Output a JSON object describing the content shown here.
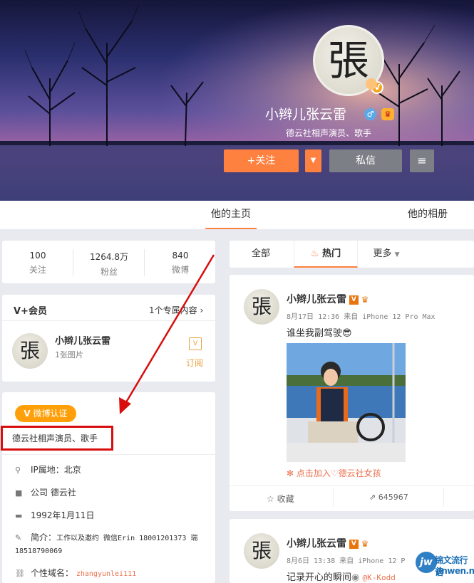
{
  "profile": {
    "avatar_glyph": "張",
    "name": "小辫儿张云雷",
    "description": "德云社相声演员、歌手",
    "follow_label": "+关注",
    "message_label": "私信"
  },
  "tabs": {
    "home": "他的主页",
    "album": "他的相册"
  },
  "stats": [
    {
      "value": "100",
      "label": "关注"
    },
    {
      "value": "1264.8万",
      "label": "粉丝"
    },
    {
      "value": "840",
      "label": "微博"
    }
  ],
  "member": {
    "title": "V+会员",
    "exclusive_link": "1个专属内容",
    "name": "小辫儿张云雷",
    "images": "1张图片",
    "subscribe": "订阅"
  },
  "verify": {
    "badge": "微博认证",
    "text": "德云社相声演员、歌手",
    "ip": "IP属地：北京",
    "company_label": "公司",
    "company": "德云社",
    "birthday": "1992年1月11日",
    "intro_label": "简介：",
    "intro": "工作以及邀约 微信Erin 18001201373 瑞18518790069",
    "domain_label": "个性域名：",
    "domain": "zhangyunlei111"
  },
  "feed": {
    "tab_all": "全部",
    "tab_hot": "热门",
    "tab_more": "更多",
    "post1": {
      "name": "小辫儿张云雷",
      "meta": "8月17日 12:36 来自 iPhone 12 Pro Max",
      "text": "谁坐我副驾驶😎",
      "join": "点击加入♡德云社女孩",
      "collect": "收藏",
      "forward_count": "645967"
    },
    "post2": {
      "name": "小辫儿张云雷",
      "meta": "8月6日 13:38 来自 iPhone 12 P",
      "text": "记录开心的瞬间",
      "mention": "@K-Kodd"
    }
  },
  "watermark": {
    "cn": "锦文流行语",
    "url": "jinwen.net",
    "logo": "jw"
  },
  "colors": {
    "accent": "#ff8140",
    "verify": "#ffa00a",
    "annotation": "#d80e0e"
  }
}
